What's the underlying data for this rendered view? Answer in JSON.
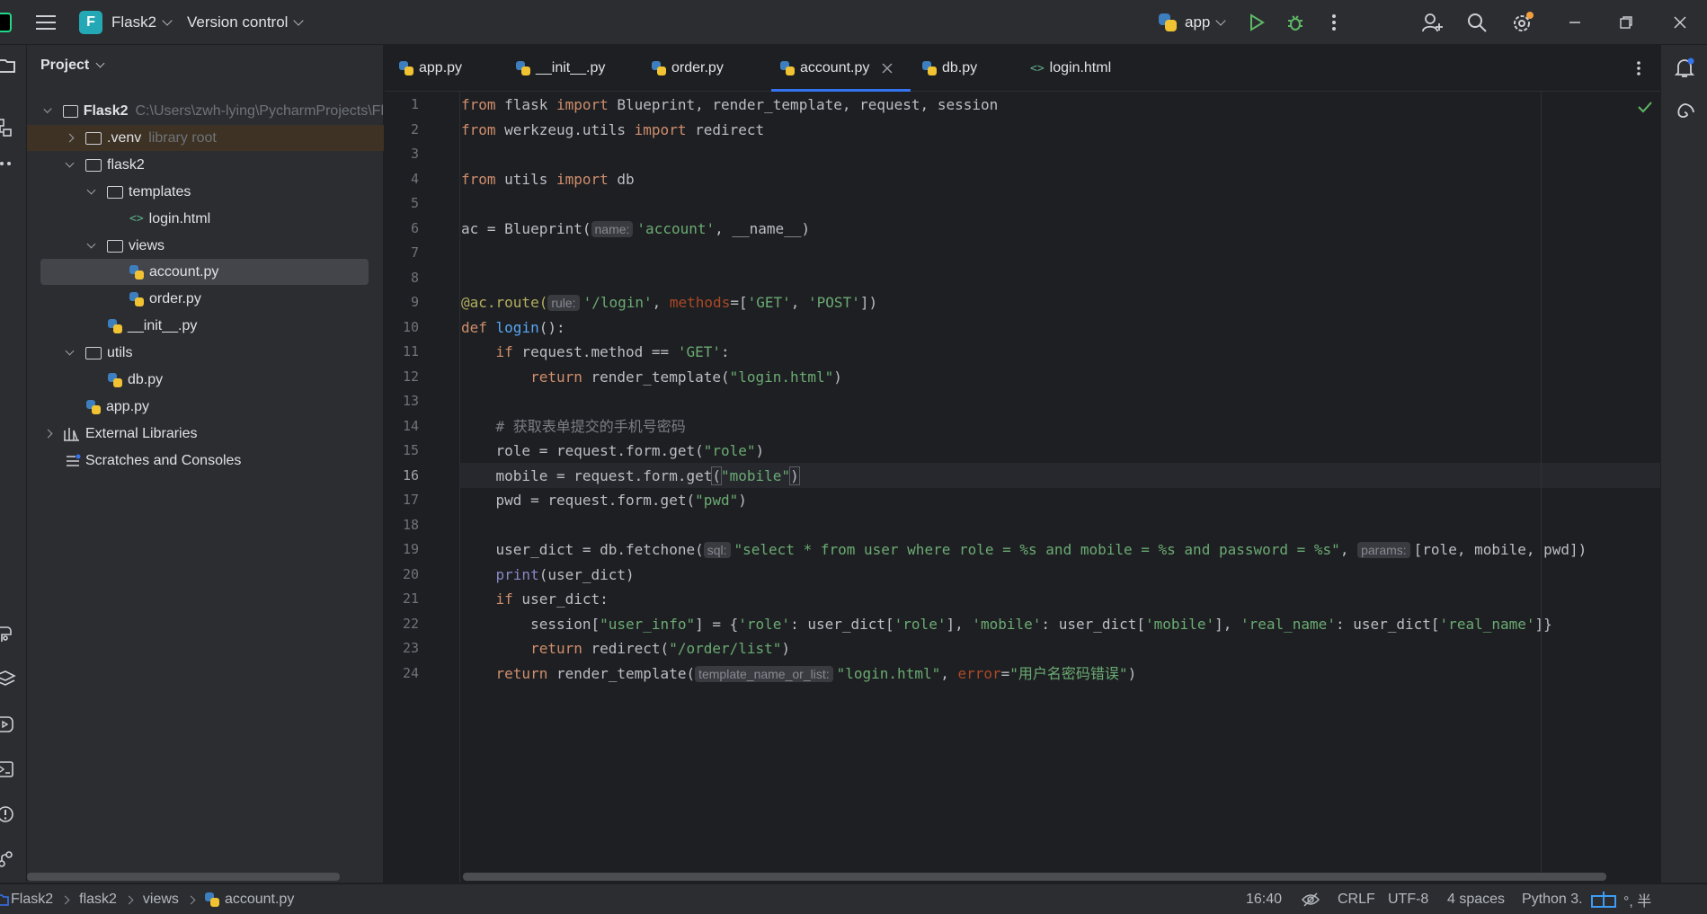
{
  "titlebar": {
    "project_badge": "F",
    "project_name": "Flask2",
    "vcs_label": "Version control",
    "run_config": "app",
    "icons": [
      "hamburger-icon",
      "python-icon",
      "run-icon",
      "debug-icon",
      "more-icon",
      "add-user-icon",
      "search-icon",
      "settings-icon",
      "minimize-icon",
      "restore-icon",
      "close-icon"
    ]
  },
  "project_panel": {
    "title": "Project",
    "tree": [
      {
        "label": "Flask2",
        "hint": "C:\\Users\\zwh-lying\\PycharmProjects\\Fl",
        "type": "root"
      },
      {
        "label": ".venv",
        "hint": "library root",
        "type": "folder"
      },
      {
        "label": "flask2",
        "type": "folder"
      },
      {
        "label": "templates",
        "type": "folder"
      },
      {
        "label": "login.html",
        "type": "html"
      },
      {
        "label": "views",
        "type": "folder"
      },
      {
        "label": "account.py",
        "type": "python",
        "selected": true
      },
      {
        "label": "order.py",
        "type": "python"
      },
      {
        "label": "__init__.py",
        "type": "python"
      },
      {
        "label": "utils",
        "type": "folder"
      },
      {
        "label": "db.py",
        "type": "python"
      },
      {
        "label": "app.py",
        "type": "python"
      },
      {
        "label": "External Libraries",
        "type": "library"
      },
      {
        "label": "Scratches and Consoles",
        "type": "scratches"
      }
    ]
  },
  "tabs": [
    {
      "label": "app.py",
      "type": "python"
    },
    {
      "label": "__init__.py",
      "type": "python"
    },
    {
      "label": "order.py",
      "type": "python"
    },
    {
      "label": "account.py",
      "type": "python",
      "active": true
    },
    {
      "label": "db.py",
      "type": "python"
    },
    {
      "label": "login.html",
      "type": "html"
    }
  ],
  "editor": {
    "current_line": 16,
    "line_numbers": [
      "1",
      "2",
      "3",
      "4",
      "5",
      "6",
      "7",
      "8",
      "9",
      "10",
      "11",
      "12",
      "13",
      "14",
      "15",
      "16",
      "17",
      "18",
      "19",
      "20",
      "21",
      "22",
      "23",
      "24"
    ],
    "inlay_hints": {
      "name": "name:",
      "rule": "rule:",
      "sql": "sql:",
      "params": "params:",
      "template_name_or_list": "template_name_or_list:"
    },
    "code": {
      "l1_from": "from",
      "l1_mod": " flask ",
      "l1_import": "import",
      "l1_rest": " Blueprint, render_template, request, session",
      "l2_from": "from",
      "l2_mod": " werkzeug.utils ",
      "l2_import": "import",
      "l2_rest": " redirect",
      "l4_from": "from",
      "l4_mod": " utils ",
      "l4_import": "import",
      "l4_rest": " db",
      "l6_a": "ac = Blueprint(",
      "l6_s": "'account'",
      "l6_b": ", __name__)",
      "l9_dec": "@ac.route(",
      "l9_s1": "'/login'",
      "l9_b": ", ",
      "l9_p": "methods",
      "l9_c": "=[",
      "l9_s2": "'GET'",
      "l9_d": ", ",
      "l9_s3": "'POST'",
      "l9_e": "])",
      "l10_def": "def",
      "l10_fn": " login",
      "l10_rest": "():",
      "l11_if": "    if",
      "l11_a": " request.method == ",
      "l11_s": "'GET'",
      "l11_b": ":",
      "l12_ret": "        return",
      "l12_a": " render_template(",
      "l12_s": "\"login.html\"",
      "l12_b": ")",
      "l14_cm": "    # 获取表单提交的手机号密码",
      "l15_a": "    role = request.form.get(",
      "l15_s": "\"role\"",
      "l15_b": ")",
      "l16_a": "    mobile = request.form.get",
      "l16_p1": "(",
      "l16_s": "\"mobile\"",
      "l16_p2": ")",
      "l17_a": "    pwd = request.form.get(",
      "l17_s": "\"pwd\"",
      "l17_b": ")",
      "l19_a": "    user_dict = db.fetchone(",
      "l19_s": "\"select * from user where role = %s and mobile = %s and password = %s\"",
      "l19_b": ", ",
      "l19_c": "[role, mobile, pwd])",
      "l20_bi": "    print",
      "l20_rest": "(user_dict)",
      "l21_if": "    if",
      "l21_rest": " user_dict:",
      "l22_a": "        session[",
      "l22_s1": "\"user_info\"",
      "l22_b": "] = {",
      "l22_s2": "'role'",
      "l22_c": ": user_dict[",
      "l22_s3": "'role'",
      "l22_d": "], ",
      "l22_s4": "'mobile'",
      "l22_e": ": user_dict[",
      "l22_s5": "'mobile'",
      "l22_f": "], ",
      "l22_s6": "'real_name'",
      "l22_g": ": user_dict[",
      "l22_s7": "'real_name'",
      "l22_h": "]}",
      "l23_ret": "        return",
      "l23_a": " redirect(",
      "l23_s": "\"/order/list\"",
      "l23_b": ")",
      "l24_ret": "    return",
      "l24_a": " render_template(",
      "l24_s": "\"login.html\"",
      "l24_b": ", ",
      "l24_p": "error",
      "l24_c": "=",
      "l24_s2": "\"用户名密码错误\"",
      "l24_d": ")"
    }
  },
  "statusbar": {
    "breadcrumb": [
      "Flask2",
      "flask2",
      "views",
      "account.py"
    ],
    "position": "16:40",
    "line_sep": "CRLF",
    "encoding": "UTF-8",
    "indent": "4 spaces",
    "interpreter": "Python 3.",
    "ime": "°, 半"
  },
  "colors": {
    "background": "#1e1f22",
    "panel": "#2b2d30",
    "accent": "#3574f0",
    "keyword": "#cf8e6d",
    "string": "#6aab73",
    "function": "#56a8f5"
  }
}
